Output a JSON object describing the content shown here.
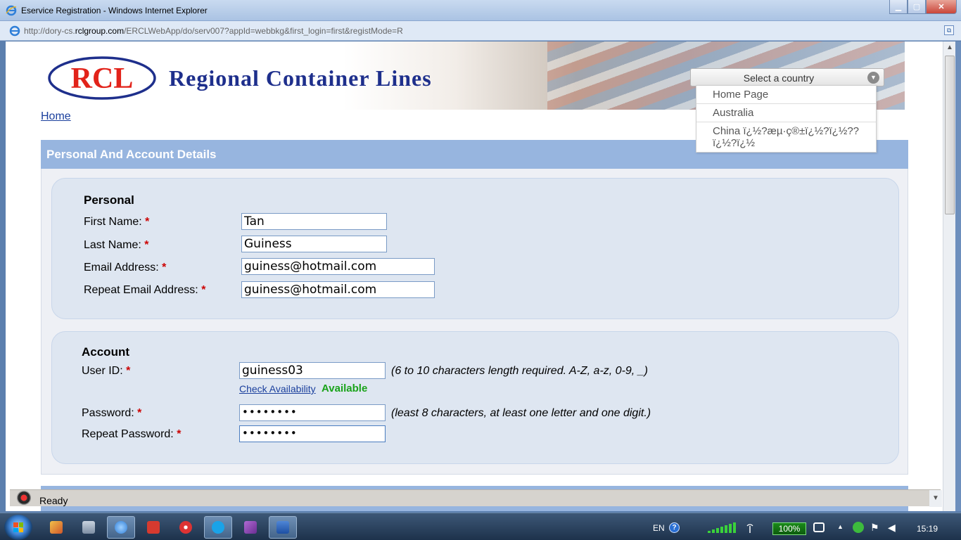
{
  "window": {
    "title": "Eservice Registration - Windows Internet Explorer",
    "url_prefix": "http://dory-cs.",
    "url_domain": "rclgroup.com",
    "url_path": "/ERCLWebApp/do/serv007?appId=webbkg&first_login=first&registMode=R"
  },
  "header": {
    "logo_text": "RCL",
    "brand_name": "Regional Container Lines",
    "country_select": {
      "selected": "Select a country",
      "options": [
        "Home Page",
        "Australia",
        "China ï¿½?æµ·ç®±ï¿½?ï¿½?? ï¿½?ï¿½"
      ]
    }
  },
  "nav": {
    "home_link": "Home"
  },
  "section": {
    "title": "Personal And Account Details"
  },
  "personal": {
    "title": "Personal",
    "first_name": {
      "label": "First Name:",
      "value": "Tan"
    },
    "last_name": {
      "label": "Last Name:",
      "value": "Guiness"
    },
    "email": {
      "label": "Email Address:",
      "value": "guiness@hotmail.com"
    },
    "repeat_email": {
      "label": "Repeat Email Address:",
      "value": "guiness@hotmail.com"
    }
  },
  "account": {
    "title": "Account",
    "user_id": {
      "label": "User ID:",
      "value": "guiness03",
      "hint": "(6 to 10 characters length required. A-Z, a-z, 0-9, _)"
    },
    "check_availability": "Check Availability",
    "availability_status": "Available",
    "password": {
      "label": "Password:",
      "value": "••••••••",
      "hint": "(least 8 characters, at least one letter and one digit.)"
    },
    "repeat_password": {
      "label": "Repeat Password:",
      "value": "••••••••"
    }
  },
  "required_marker": "*",
  "statusbar": {
    "text": "Ready"
  },
  "taskbar": {
    "language": "EN",
    "battery": "100%",
    "clock": "15:19",
    "apps": [
      "paint-app",
      "calculator-app",
      "internet-explorer-app",
      "pdf-app",
      "media-app",
      "skype-app",
      "onenote-app",
      "word-app"
    ]
  },
  "colors": {
    "section_header": "#97b5df",
    "panel_bg": "#dee6f1",
    "brand_blue": "#1e2f8c",
    "logo_red": "#e2231a",
    "required_red": "#cc0000",
    "available_green": "#1aa31a"
  }
}
